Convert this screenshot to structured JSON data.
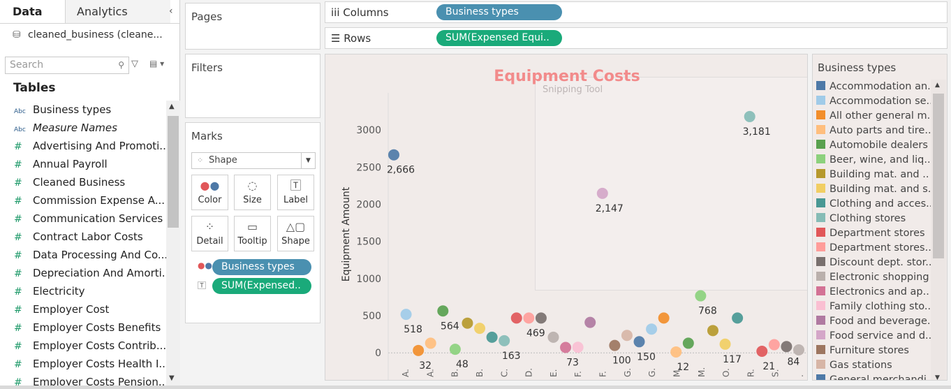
{
  "left_pane": {
    "tab_data": "Data",
    "tab_analytics": "Analytics",
    "datasource": "cleaned_business (cleane...",
    "search_placeholder": "Search",
    "tables_heading": "Tables",
    "fields": [
      {
        "type": "Abc",
        "name": "Business types",
        "italic": false
      },
      {
        "type": "Abc",
        "name": "Measure Names",
        "italic": true
      },
      {
        "type": "#",
        "name": "Advertising And Promoti...",
        "italic": false
      },
      {
        "type": "#",
        "name": "Annual Payroll",
        "italic": false
      },
      {
        "type": "#",
        "name": "Cleaned Business",
        "italic": false
      },
      {
        "type": "#",
        "name": "Commission Expense A...",
        "italic": false
      },
      {
        "type": "#",
        "name": "Communication Services",
        "italic": false
      },
      {
        "type": "#",
        "name": "Contract Labor Costs",
        "italic": false
      },
      {
        "type": "#",
        "name": "Data Processing And Co...",
        "italic": false
      },
      {
        "type": "#",
        "name": "Depreciation And Amorti...",
        "italic": false
      },
      {
        "type": "#",
        "name": "Electricity",
        "italic": false
      },
      {
        "type": "#",
        "name": "Employer Cost",
        "italic": false
      },
      {
        "type": "#",
        "name": "Employer Costs Benefits",
        "italic": false
      },
      {
        "type": "#",
        "name": "Employer Costs Contrib...",
        "italic": false
      },
      {
        "type": "#",
        "name": "Employer Costs Health I...",
        "italic": false
      },
      {
        "type": "#",
        "name": "Employer Costs Pension...",
        "italic": false
      }
    ]
  },
  "pages_label": "Pages",
  "filters_label": "Filters",
  "marks": {
    "label": "Marks",
    "type": "Shape",
    "buttons": [
      "Color",
      "Size",
      "Label",
      "Detail",
      "Tooltip",
      "Shape"
    ],
    "pill_color": "Business types",
    "pill_label": "SUM(Expensed.."
  },
  "columns": {
    "label": "Columns",
    "pill": "Business types"
  },
  "rows": {
    "label": "Rows",
    "pill": "SUM(Expensed Equi.."
  },
  "watermark": "Snipping Tool",
  "chart_data": {
    "type": "scatter",
    "title": "Equipment Costs",
    "ylabel": "Equipment Amount",
    "ylim": [
      -120,
      3500
    ],
    "yticks": [
      0,
      500,
      1000,
      1500,
      2000,
      2500,
      3000
    ],
    "xtick_labels": [
      "A.",
      "A.",
      "B.",
      "B.",
      "C.",
      "D.",
      "E.",
      "F.",
      "F.",
      "G.",
      "G.",
      "M.",
      "M.",
      "O.",
      "R.",
      "S.",
      "."
    ],
    "points": [
      {
        "i": 0,
        "y": 2666,
        "color": "#4e79a7",
        "label": "2,666"
      },
      {
        "i": 1,
        "y": 518,
        "color": "#a0cbe8",
        "label": "518"
      },
      {
        "i": 2,
        "y": 32,
        "color": "#f28e2b",
        "label": "32"
      },
      {
        "i": 3,
        "y": 130,
        "color": "#ffbe7d",
        "label": ""
      },
      {
        "i": 4,
        "y": 564,
        "color": "#59a14f",
        "label": "564"
      },
      {
        "i": 5,
        "y": 48,
        "color": "#8cd17d",
        "label": "48"
      },
      {
        "i": 6,
        "y": 400,
        "color": "#b6992d",
        "label": ""
      },
      {
        "i": 7,
        "y": 330,
        "color": "#f1ce63",
        "label": ""
      },
      {
        "i": 8,
        "y": 210,
        "color": "#499894",
        "label": ""
      },
      {
        "i": 9,
        "y": 163,
        "color": "#86bcb6",
        "label": "163"
      },
      {
        "i": 10,
        "y": 469,
        "color": "#e15759",
        "label": ""
      },
      {
        "i": 11,
        "y": 469,
        "color": "#ff9d9a",
        "label": "469"
      },
      {
        "i": 12,
        "y": 469,
        "color": "#79706e",
        "label": ""
      },
      {
        "i": 13,
        "y": 210,
        "color": "#bab0ac",
        "label": ""
      },
      {
        "i": 14,
        "y": 73,
        "color": "#d37295",
        "label": "73"
      },
      {
        "i": 15,
        "y": 75,
        "color": "#fabfd2",
        "label": ""
      },
      {
        "i": 16,
        "y": 410,
        "color": "#b07aa1",
        "label": ""
      },
      {
        "i": 17,
        "y": 2147,
        "color": "#d4a6c8",
        "label": "2,147"
      },
      {
        "i": 18,
        "y": 100,
        "color": "#9d7660",
        "label": "100"
      },
      {
        "i": 19,
        "y": 235,
        "color": "#d7b5a6",
        "label": ""
      },
      {
        "i": 20,
        "y": 150,
        "color": "#4e79a7",
        "label": "150"
      },
      {
        "i": 21,
        "y": 320,
        "color": "#a0cbe8",
        "label": ""
      },
      {
        "i": 22,
        "y": 469,
        "color": "#f28e2b",
        "label": ""
      },
      {
        "i": 23,
        "y": 12,
        "color": "#ffbe7d",
        "label": "12"
      },
      {
        "i": 24,
        "y": 130,
        "color": "#59a14f",
        "label": ""
      },
      {
        "i": 25,
        "y": 768,
        "color": "#8cd17d",
        "label": "768"
      },
      {
        "i": 26,
        "y": 300,
        "color": "#b6992d",
        "label": ""
      },
      {
        "i": 27,
        "y": 117,
        "color": "#f1ce63",
        "label": "117"
      },
      {
        "i": 28,
        "y": 469,
        "color": "#499894",
        "label": ""
      },
      {
        "i": 29,
        "y": 3181,
        "color": "#86bcb6",
        "label": "3,181"
      },
      {
        "i": 30,
        "y": 21,
        "color": "#e15759",
        "label": "21"
      },
      {
        "i": 31,
        "y": 110,
        "color": "#ff9d9a",
        "label": ""
      },
      {
        "i": 32,
        "y": 84,
        "color": "#79706e",
        "label": "84"
      },
      {
        "i": 33,
        "y": 40,
        "color": "#bab0ac",
        "label": ""
      }
    ]
  },
  "legend": {
    "title": "Business types",
    "items": [
      {
        "name": "Accommodation an..",
        "color": "#4e79a7"
      },
      {
        "name": "Accommodation se..",
        "color": "#a0cbe8"
      },
      {
        "name": "All other general m..",
        "color": "#f28e2b"
      },
      {
        "name": "Auto parts and tire..",
        "color": "#ffbe7d"
      },
      {
        "name": "Automobile dealers",
        "color": "#59a14f"
      },
      {
        "name": "Beer, wine, and liq..",
        "color": "#8cd17d"
      },
      {
        "name": "Building mat. and ..",
        "color": "#b6992d"
      },
      {
        "name": "Building mat. and s..",
        "color": "#f1ce63"
      },
      {
        "name": "Clothing and acces..",
        "color": "#499894"
      },
      {
        "name": "Clothing stores",
        "color": "#86bcb6"
      },
      {
        "name": "Department stores",
        "color": "#e15759"
      },
      {
        "name": "Department stores..",
        "color": "#ff9d9a"
      },
      {
        "name": "Discount dept. stor..",
        "color": "#79706e"
      },
      {
        "name": "Electronic shopping",
        "color": "#bab0ac"
      },
      {
        "name": "Electronics and ap..",
        "color": "#d37295"
      },
      {
        "name": "Family clothing sto..",
        "color": "#fabfd2"
      },
      {
        "name": "Food and beverage..",
        "color": "#b07aa1"
      },
      {
        "name": "Food service and d..",
        "color": "#d4a6c8"
      },
      {
        "name": "Furniture stores",
        "color": "#9d7660"
      },
      {
        "name": "Gas stations",
        "color": "#d7b5a6"
      },
      {
        "name": "General merchandi..",
        "color": "#4e79a7"
      }
    ]
  },
  "colors": {
    "title": "#f28b8b",
    "dimension_pill": "#4a90b0",
    "measure_pill": "#1aaa7a"
  }
}
